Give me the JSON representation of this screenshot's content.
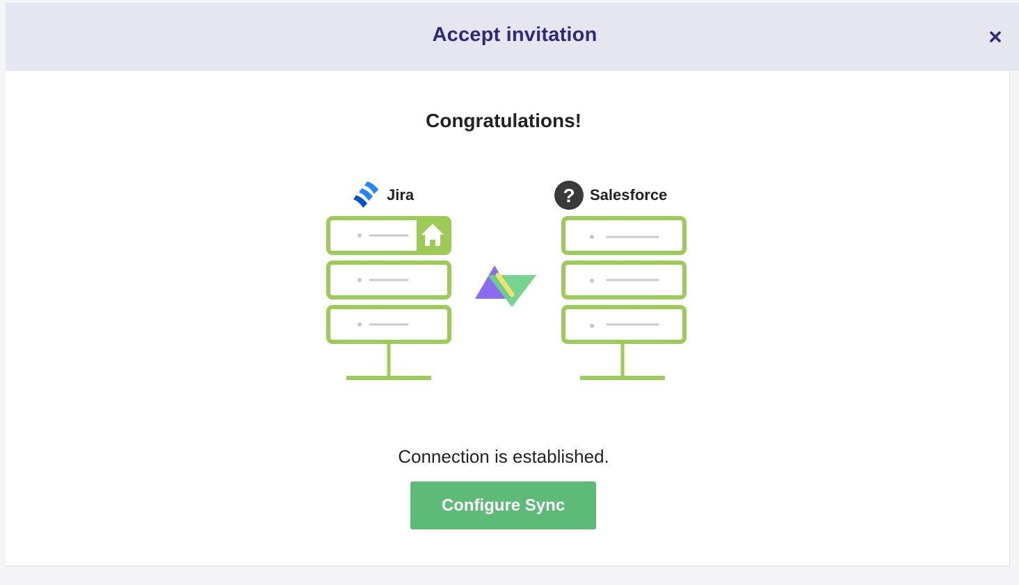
{
  "dialog": {
    "title": "Accept invitation",
    "close_icon": "close-icon"
  },
  "content": {
    "heading": "Congratulations!",
    "left_app": {
      "name": "Jira",
      "icon": "jira-logo-icon"
    },
    "right_app": {
      "name": "Salesforce",
      "icon": "question-mark-icon"
    },
    "connector_icon": "exalate-logo-icon",
    "status": "Connection is established.",
    "primary_button_label": "Configure Sync"
  },
  "colors": {
    "header_bg": "#e6e6f1",
    "title": "#2e2a7a",
    "server_green": "#9ccc56",
    "button_green": "#5dba77",
    "jira_blue": "#2684ff",
    "connector_purple": "#8b6cf0",
    "connector_green": "#6fd18a"
  }
}
